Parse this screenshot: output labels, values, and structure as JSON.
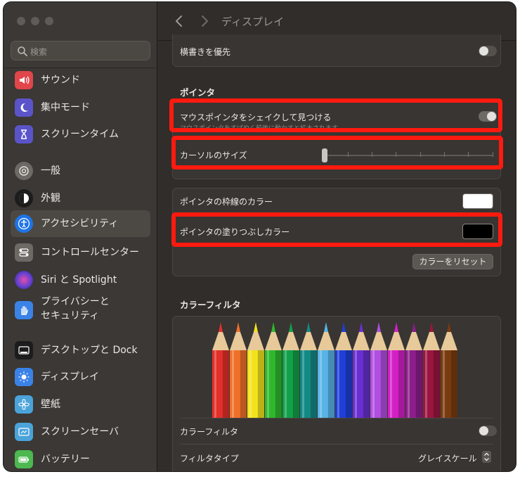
{
  "window": {
    "title": "ディスプレイ"
  },
  "search": {
    "placeholder": "検索"
  },
  "sidebar": {
    "items": [
      {
        "label": "サウンド",
        "icon": "speaker-icon",
        "color": "#e0464a"
      },
      {
        "label": "集中モード",
        "icon": "moon-icon",
        "color": "#5b54c9"
      },
      {
        "label": "スクリーンタイム",
        "icon": "hourglass-icon",
        "color": "#5b54c9"
      },
      {
        "label": "一般",
        "icon": "gear-icon",
        "color": "#6d6a66"
      },
      {
        "label": "外観",
        "icon": "appearance-icon",
        "color": "#1c1c1c"
      },
      {
        "label": "アクセシビリティ",
        "icon": "accessibility-icon",
        "color": "#1f74e6",
        "active": true
      },
      {
        "label": "コントロールセンター",
        "icon": "control-center-icon",
        "color": "#6d6a66"
      },
      {
        "label": "Siri と Spotlight",
        "icon": "siri-icon",
        "color": "#7b3fc7"
      },
      {
        "label": "プライバシーと\nセキュリティ",
        "icon": "hand-icon",
        "color": "#3b82e6"
      },
      {
        "label": "デスクトップと Dock",
        "icon": "dock-icon",
        "color": "#1c1c1c"
      },
      {
        "label": "ディスプレイ",
        "icon": "brightness-icon",
        "color": "#3b82e6"
      },
      {
        "label": "壁紙",
        "icon": "flower-icon",
        "color": "#4aa3d9"
      },
      {
        "label": "スクリーンセーバ",
        "icon": "screensaver-icon",
        "color": "#4aa3d9"
      },
      {
        "label": "バッテリー",
        "icon": "battery-icon",
        "color": "#4cb84f"
      }
    ]
  },
  "content": {
    "horizontal_text_label": "横書きを優先",
    "horizontal_text_on": false,
    "pointer_section": "ポインタ",
    "shake_label": "マウスポインタをシェイクして見つける",
    "shake_on": true,
    "cursor_size_label": "カーソルのサイズ",
    "cursor_size_value": 0.0,
    "outline_color_label": "ポインタの枠線のカラー",
    "outline_color": "#ffffff",
    "fill_color_label": "ポインタの塗りつぶしカラー",
    "fill_color": "#000000",
    "reset_button": "カラーをリセット",
    "color_filter_section": "カラーフィルタ",
    "color_filter_label": "カラーフィルタ",
    "color_filter_on": false,
    "filter_type_label": "フィルタタイプ",
    "filter_type_value": "グレイスケール",
    "pencil_colors": [
      "#e3302a",
      "#f0702a",
      "#f2e21d",
      "#2fb82d",
      "#12a04a",
      "#128a86",
      "#58b4e6",
      "#1f3fd6",
      "#6a2fd0",
      "#b04fe0",
      "#d41fc6",
      "#8a1e8a",
      "#9a1540",
      "#7a3b10"
    ]
  },
  "highlight_color": "#ff1a0f"
}
